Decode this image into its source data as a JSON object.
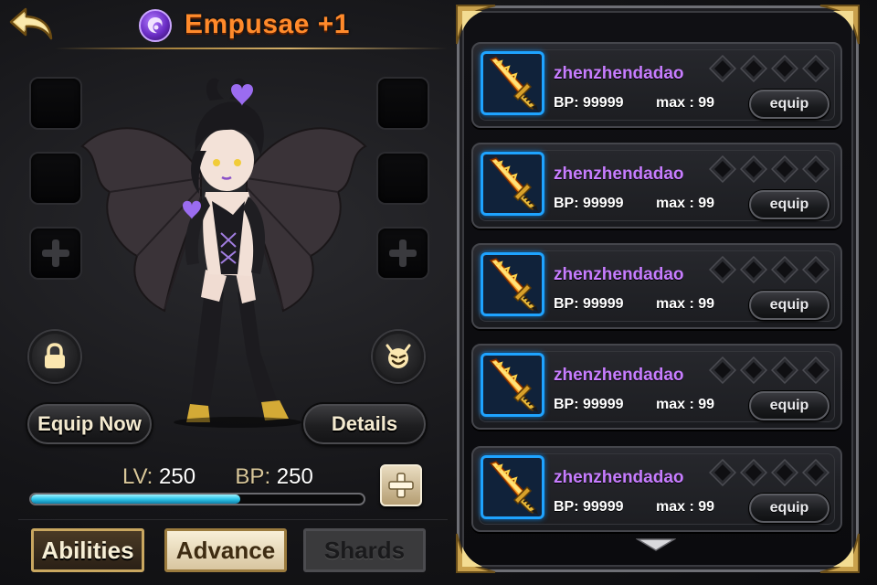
{
  "header": {
    "back_icon": "back-arrow-icon",
    "element_icon": "dark-element-icon",
    "monster_name": "Empusae +1"
  },
  "slots": {
    "left": [
      "empty",
      "empty",
      "add"
    ],
    "right": [
      "empty",
      "empty",
      "add"
    ]
  },
  "controls": {
    "lock_icon": "lock-icon",
    "devil_icon": "devil-face-icon",
    "equip_now_label": "Equip Now",
    "details_label": "Details"
  },
  "stats": {
    "lv_label": "LV:",
    "lv_value": "250",
    "bp_label": "BP:",
    "bp_value": "250",
    "progress_fraction": 0.63,
    "add_icon": "plus-icon"
  },
  "tabs": [
    {
      "label": "Abilities",
      "state": "normal"
    },
    {
      "label": "Advance",
      "state": "selected"
    },
    {
      "label": "Shards",
      "state": "disabled"
    }
  ],
  "items": [
    {
      "name": "zhenzhendadao",
      "bp": "BP: 99999",
      "max": "max : 99",
      "button": "equip",
      "icon": "flame-sword-icon"
    },
    {
      "name": "zhenzhendadao",
      "bp": "BP: 99999",
      "max": "max : 99",
      "button": "equip",
      "icon": "flame-sword-icon"
    },
    {
      "name": "zhenzhendadao",
      "bp": "BP: 99999",
      "max": "max : 99",
      "button": "equip",
      "icon": "flame-sword-icon"
    },
    {
      "name": "zhenzhendadao",
      "bp": "BP: 99999",
      "max": "max : 99",
      "button": "equip",
      "icon": "flame-sword-icon"
    },
    {
      "name": "zhenzhendadao",
      "bp": "BP: 99999",
      "max": "max : 99",
      "button": "equip",
      "icon": "flame-sword-icon"
    }
  ],
  "colors": {
    "name_orange": "#ff8a2b",
    "item_name_purple": "#c77dff",
    "icon_border_blue": "#1ea3ff",
    "progress_cyan": "#2ec6ea"
  }
}
